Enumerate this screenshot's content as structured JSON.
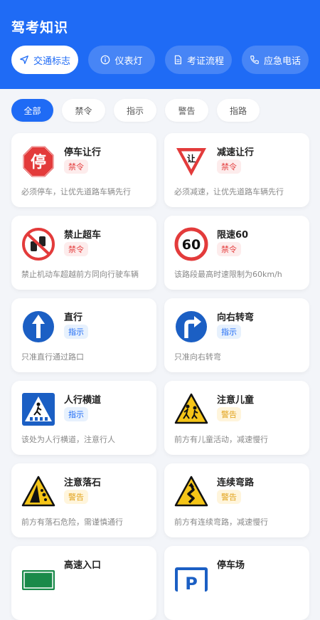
{
  "app": {
    "title": "驾考知识"
  },
  "nav_tabs": [
    {
      "label": "交通标志",
      "icon": "navigation-icon"
    },
    {
      "label": "仪表灯",
      "icon": "info-icon"
    },
    {
      "label": "考证流程",
      "icon": "document-icon"
    },
    {
      "label": "应急电话",
      "icon": "phone-icon"
    }
  ],
  "filters": [
    "全部",
    "禁令",
    "指示",
    "警告",
    "指路"
  ],
  "cards": [
    {
      "name": "停车让行",
      "tag": "禁令",
      "desc": "必须停车，让优先道路车辆先行",
      "sign_text": "停"
    },
    {
      "name": "减速让行",
      "tag": "禁令",
      "desc": "必须减速，让优先道路车辆先行",
      "sign_text": "让"
    },
    {
      "name": "禁止超车",
      "tag": "禁令",
      "desc": "禁止机动车超越前方同向行驶车辆"
    },
    {
      "name": "限速60",
      "tag": "禁令",
      "desc": "该路段最高时速限制为60km/h",
      "sign_text": "60"
    },
    {
      "name": "直行",
      "tag": "指示",
      "desc": "只准直行通过路口"
    },
    {
      "name": "向右转弯",
      "tag": "指示",
      "desc": "只准向右转弯"
    },
    {
      "name": "人行横道",
      "tag": "指示",
      "desc": "该处为人行横道，注意行人"
    },
    {
      "name": "注意儿童",
      "tag": "警告",
      "desc": "前方有儿童活动，减速慢行"
    },
    {
      "name": "注意落石",
      "tag": "警告",
      "desc": "前方有落石危险，需谨慎通行"
    },
    {
      "name": "连续弯路",
      "tag": "警告",
      "desc": "前方有连续弯路，减速慢行"
    },
    {
      "name": "高速入口",
      "tag": "",
      "desc": ""
    },
    {
      "name": "停车场",
      "tag": "",
      "desc": "",
      "sign_text": "P"
    }
  ],
  "colors": {
    "primary": "#1f6bf5",
    "prohibit": "#e54545",
    "instruct": "#1f6bf5",
    "warn": "#e1a21a"
  }
}
